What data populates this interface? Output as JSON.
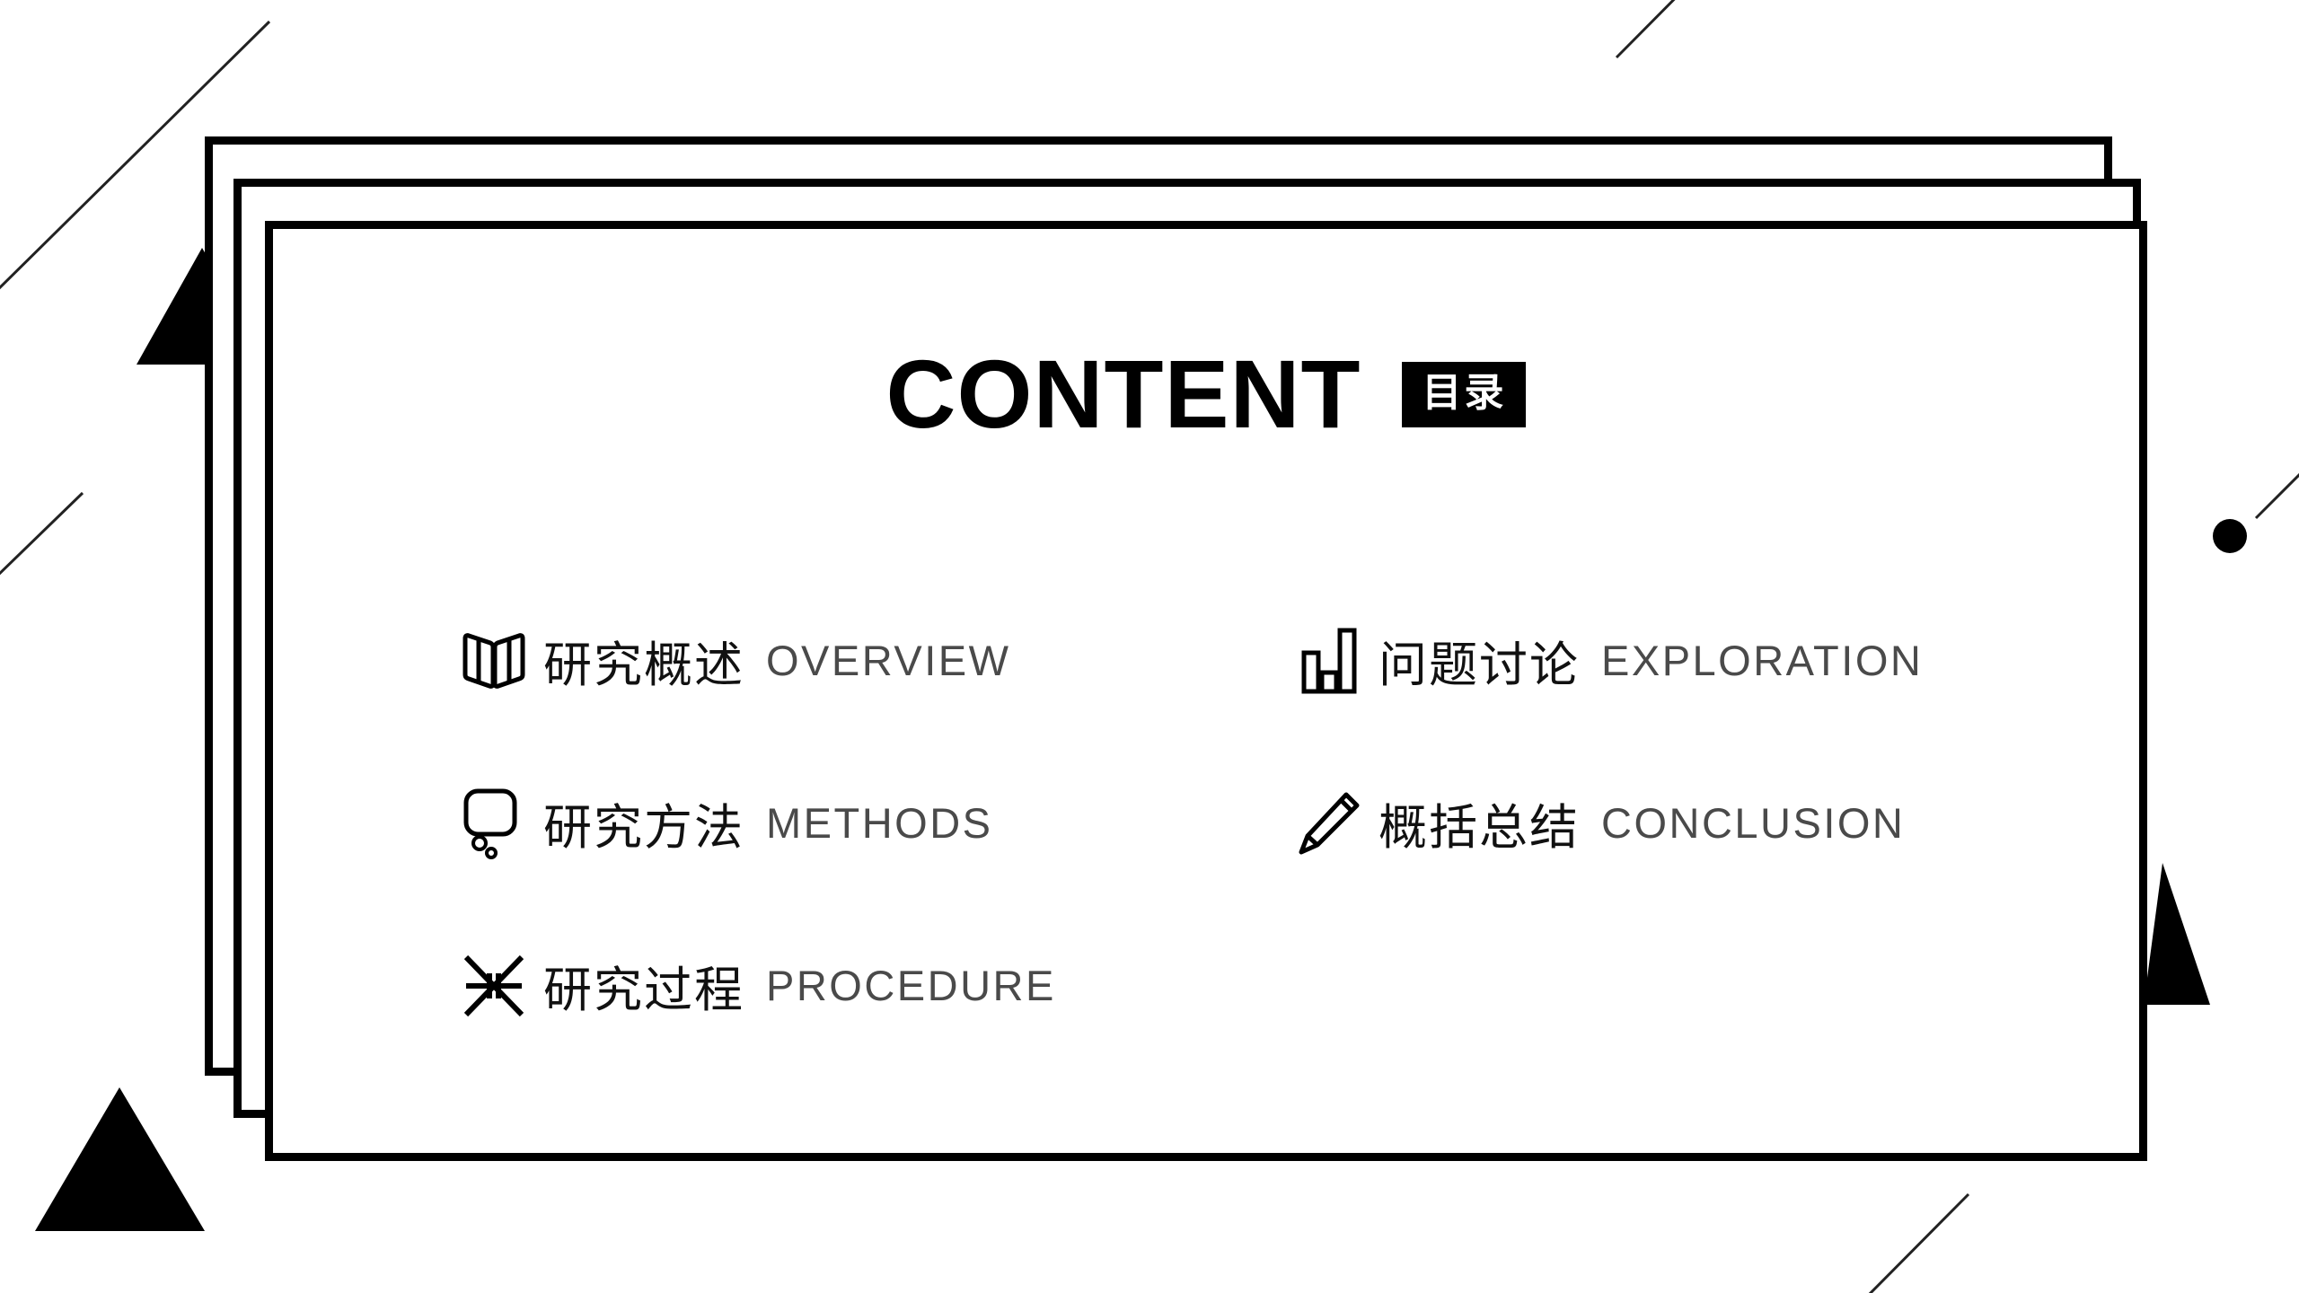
{
  "slide": {
    "background_color": "#ffffff",
    "ink_color": "#000000",
    "accent_text_color": "#4a4a4a"
  },
  "header": {
    "title": "CONTENT",
    "badge_label": "目录",
    "badge_bg": "#000000",
    "badge_fg": "#ffffff"
  },
  "toc": {
    "items": [
      {
        "icon": "open-book-icon",
        "cn": "研究概述",
        "en": "OVERVIEW",
        "column": "left",
        "row": 1
      },
      {
        "icon": "bar-chart-icon",
        "cn": "问题讨论",
        "en": "EXPLORATION",
        "column": "right",
        "row": 1
      },
      {
        "icon": "speech-bubble-icon",
        "cn": "研究方法",
        "en": "METHODS",
        "column": "left",
        "row": 2
      },
      {
        "icon": "pencil-icon",
        "cn": "概括总结",
        "en": "CONCLUSION",
        "column": "right",
        "row": 2
      },
      {
        "icon": "collapse-arrows-icon",
        "cn": "研究过程",
        "en": "PROCEDURE",
        "column": "left",
        "row": 3
      }
    ]
  },
  "decorations": {
    "frames": [
      {
        "name": "card-frame-back"
      },
      {
        "name": "card-frame-middle"
      },
      {
        "name": "card-frame-front"
      }
    ],
    "shapes": [
      {
        "name": "triangle-top-left"
      },
      {
        "name": "triangle-bottom-left"
      },
      {
        "name": "triangle-right"
      },
      {
        "name": "dot-right"
      },
      {
        "name": "diagonal-line-top-left"
      },
      {
        "name": "diagonal-line-left"
      },
      {
        "name": "diagonal-line-top-right"
      },
      {
        "name": "diagonal-line-bottom-right"
      }
    ]
  }
}
